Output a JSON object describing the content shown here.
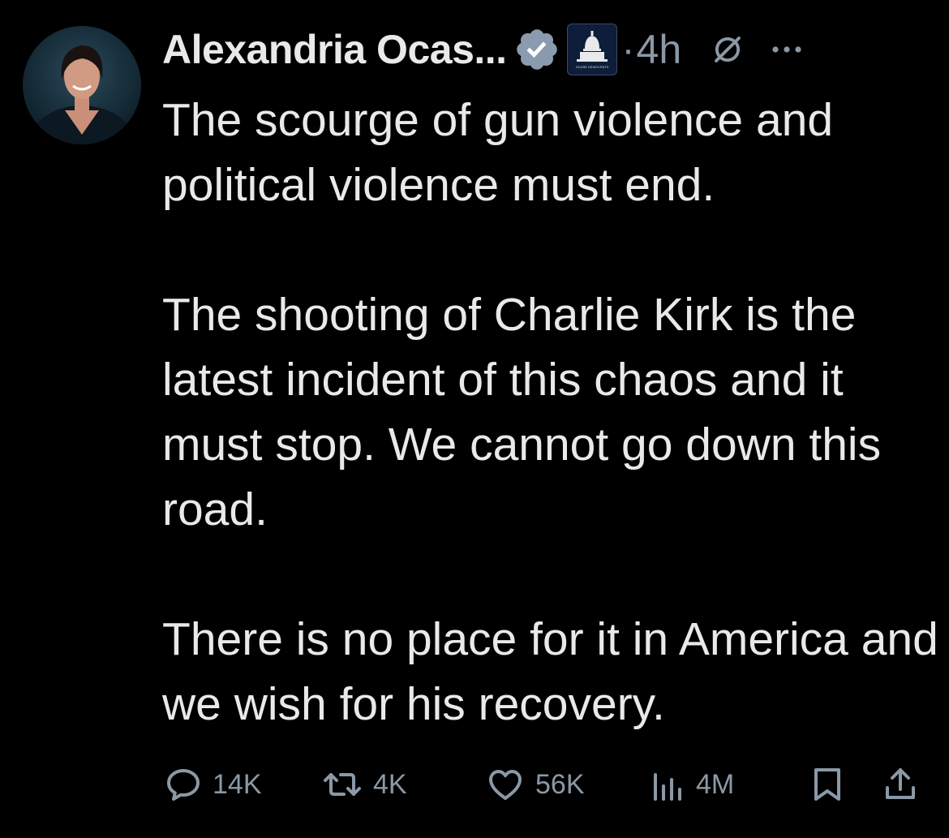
{
  "author": {
    "name": "Alexandria Ocas...",
    "verified_icon": "verified-badge-icon",
    "affiliation_icon": "house-democrats-logo",
    "affiliation_text": "HOUSE DEMOCRATS",
    "dot": "·",
    "time": "4h"
  },
  "tweet": {
    "paragraphs": [
      "The scourge of gun violence and political violence must end.",
      "The shooting of Charlie Kirk is the latest incident of this chaos and it must stop. We cannot go down this road.",
      "There is no place for it in America and we wish for his recovery."
    ]
  },
  "actions": {
    "reply": {
      "icon": "reply-icon",
      "count": "14K"
    },
    "repost": {
      "icon": "repost-icon",
      "count": "4K"
    },
    "like": {
      "icon": "heart-icon",
      "count": "56K"
    },
    "views": {
      "icon": "views-icon",
      "count": "4M"
    },
    "bookmark": {
      "icon": "bookmark-icon"
    },
    "share": {
      "icon": "share-icon"
    }
  },
  "colors": {
    "background": "#000000",
    "text": "#e7e9ea",
    "muted": "#8b98a5",
    "verified": "#8a9bb0"
  }
}
